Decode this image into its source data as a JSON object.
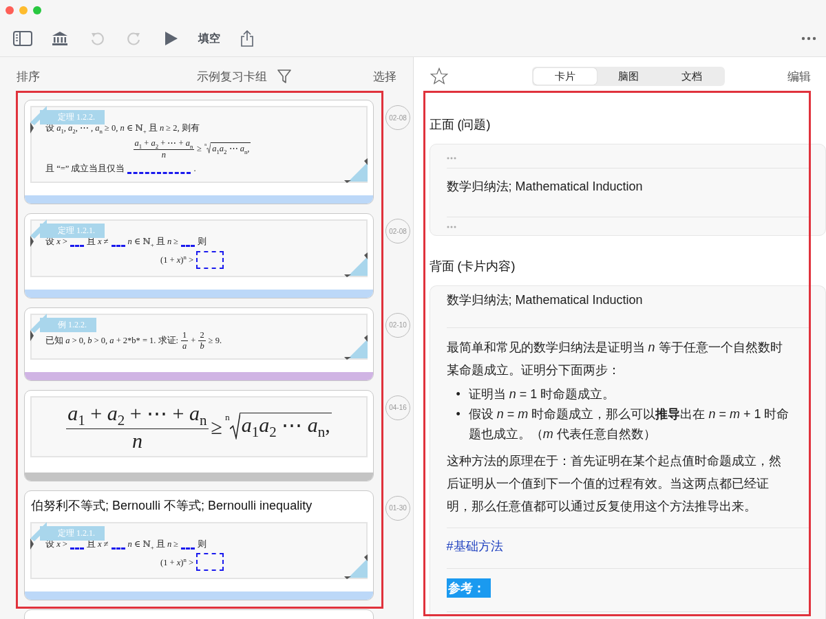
{
  "window": {
    "controls": [
      {
        "color": "#fe5f57"
      },
      {
        "color": "#febc2e"
      },
      {
        "color": "#28c840"
      }
    ]
  },
  "toolbar": [
    {
      "kind": "icon",
      "disabled": false
    },
    {
      "kind": "icon",
      "disabled": false
    },
    {
      "kind": "icon",
      "disabled": true
    },
    {
      "kind": "icon",
      "disabled": true
    },
    {
      "kind": "icon",
      "disabled": false
    },
    {
      "kind": "text",
      "label": "填空",
      "disabled": false
    },
    {
      "kind": "icon",
      "disabled": false
    }
  ],
  "list_header": {
    "sort": "排序",
    "deck": "示例复习卡组",
    "select": "选择"
  },
  "cards": [
    {
      "date": "02-08",
      "color": "#bcd8f8",
      "doc": {
        "kind": "excerpt",
        "tag": "定理 1.2.2.",
        "lines": [
          {
            "kind": "text",
            "parts": [
              {
                "kind": "text",
                "text": "设 *a*$_{1}$, *a*$_{2}$, ⋯ , *a*$_{n}$ ≥ 0, *n* ∈ ℕ$_{+}$ 且 *n* ≥ 2, 则有"
              }
            ]
          },
          {
            "kind": "display",
            "parts": [
              {
                "kind": "frac",
                "num": "*a*$_{1}$ + *a*$_{2}$ + ⋯ + *a*$_{n}$",
                "den": "*n*"
              },
              {
                "kind": "text",
                "text": "≥"
              },
              {
                "kind": "root",
                "index": "n",
                "radicand": "*a*$_{1}$*a*$_{2}$ ⋯ *a*$_{n}$,"
              }
            ]
          },
          {
            "kind": "text",
            "parts": [
              {
                "kind": "text",
                "text": "且 “=” 成立当且仅当"
              },
              {
                "kind": "long-blank"
              },
              {
                "kind": "text",
                "text": "."
              }
            ]
          }
        ]
      }
    },
    {
      "date": "02-08",
      "color": "#bcd8f8",
      "doc": {
        "kind": "excerpt",
        "tag": "定理 1.2.1.",
        "lines": [
          {
            "kind": "text",
            "parts": [
              {
                "kind": "text",
                "text": "设 *x* >"
              },
              {
                "kind": "blank"
              },
              {
                "kind": "text",
                "text": "且 *x* ≠"
              },
              {
                "kind": "blank"
              },
              {
                "kind": "text",
                "text": "*n* ∈ ℕ$_{+}$ 且 *n* ≥"
              },
              {
                "kind": "blank"
              },
              {
                "kind": "text",
                "text": "则"
              }
            ]
          },
          {
            "kind": "display",
            "parts": [
              {
                "kind": "text",
                "text": "(1 + *x*)$^{n}$ >"
              },
              {
                "kind": "box"
              }
            ]
          }
        ]
      }
    },
    {
      "date": "02-10",
      "color": "#d0b4e4",
      "doc": {
        "kind": "excerpt",
        "tag": "例 1.2.2.",
        "lines": [
          {
            "kind": "text",
            "parts": [
              {
                "kind": "text",
                "text": "已知 *a* > 0, *b* > 0, *a* + 2*b* = 1. 求证:"
              },
              {
                "kind": "frac",
                "num": "1",
                "den": "*a*"
              },
              {
                "kind": "text",
                "text": "+"
              },
              {
                "kind": "frac",
                "num": "2",
                "den": "*b*"
              },
              {
                "kind": "text",
                "text": "≥ 9."
              }
            ]
          }
        ]
      }
    },
    {
      "date": "04-16",
      "color": "#c4c4c4",
      "doc": {
        "kind": "formula",
        "lines": [
          {
            "kind": "display",
            "parts": [
              {
                "kind": "frac",
                "num": "*a*$_{1}$ + *a*$_{2}$ + ⋯ + *a*$_{n}$",
                "den": "*n*"
              },
              {
                "kind": "text",
                "text": "≥"
              },
              {
                "kind": "root",
                "index": "n",
                "radicand": "*a*$_{1}$*a*$_{2}$ ⋯ *a*$_{n}$,"
              }
            ]
          }
        ]
      }
    },
    {
      "title": "伯努利不等式; Bernoulli 不等式; Bernoulli inequality",
      "date": "01-30",
      "color": "#bcd8f8",
      "doc": {
        "kind": "excerpt",
        "tag": "定理 1.2.1.",
        "lines": [
          {
            "kind": "text",
            "parts": [
              {
                "kind": "text",
                "text": "设 *x* >"
              },
              {
                "kind": "blank"
              },
              {
                "kind": "text",
                "text": "且 *x* ≠"
              },
              {
                "kind": "blank"
              },
              {
                "kind": "text",
                "text": "*n* ∈ ℕ$_{+}$ 且 *n* ≥"
              },
              {
                "kind": "blank"
              },
              {
                "kind": "text",
                "text": "则"
              }
            ]
          },
          {
            "kind": "display",
            "parts": [
              {
                "kind": "text",
                "text": "(1 + *x*)$^{n}$ >"
              },
              {
                "kind": "box"
              }
            ]
          }
        ]
      }
    }
  ],
  "detail": {
    "starred": false,
    "tabs": [
      {
        "label": "卡片",
        "selected": true
      },
      {
        "label": "脑图",
        "selected": false
      },
      {
        "label": "文档",
        "selected": false
      }
    ],
    "edit": "编辑",
    "front_heading": "正面 (问题)",
    "front": "数学归纳法; Mathematical Induction",
    "back_heading": "背面 (卡片内容)",
    "back": [
      {
        "kind": "title",
        "text": "数学归纳法; Mathematical Induction"
      },
      {
        "kind": "divider"
      },
      {
        "kind": "paragraph",
        "text": "最简单和常见的数学归纳法是证明当 *n* 等于任意一个自然数时某命题成立。证明分下面两步："
      },
      {
        "kind": "bullets",
        "items": [
          {
            "marker": "•",
            "text": "证明当 *n* = 1 时命题成立。"
          },
          {
            "marker": "•",
            "text": "假设 *n* = *m* 时命题成立，那么可以**推导**出在 *n* = *m* + 1 时命题也成立。（*m* 代表任意自然数）"
          }
        ]
      },
      {
        "kind": "paragraph",
        "text": "这种方法的原理在于：首先证明在某个起点值时命题成立，然后证明从一个值到下一个值的过程有效。当这两点都已经证明，那么任意值都可以通过反复使用这个方法推导出来。"
      },
      {
        "kind": "divider"
      },
      {
        "kind": "hashtag",
        "text": "#基础方法"
      },
      {
        "kind": "divider"
      },
      {
        "kind": "highlight",
        "text": "参考："
      },
      {
        "kind": "divider"
      }
    ]
  }
}
